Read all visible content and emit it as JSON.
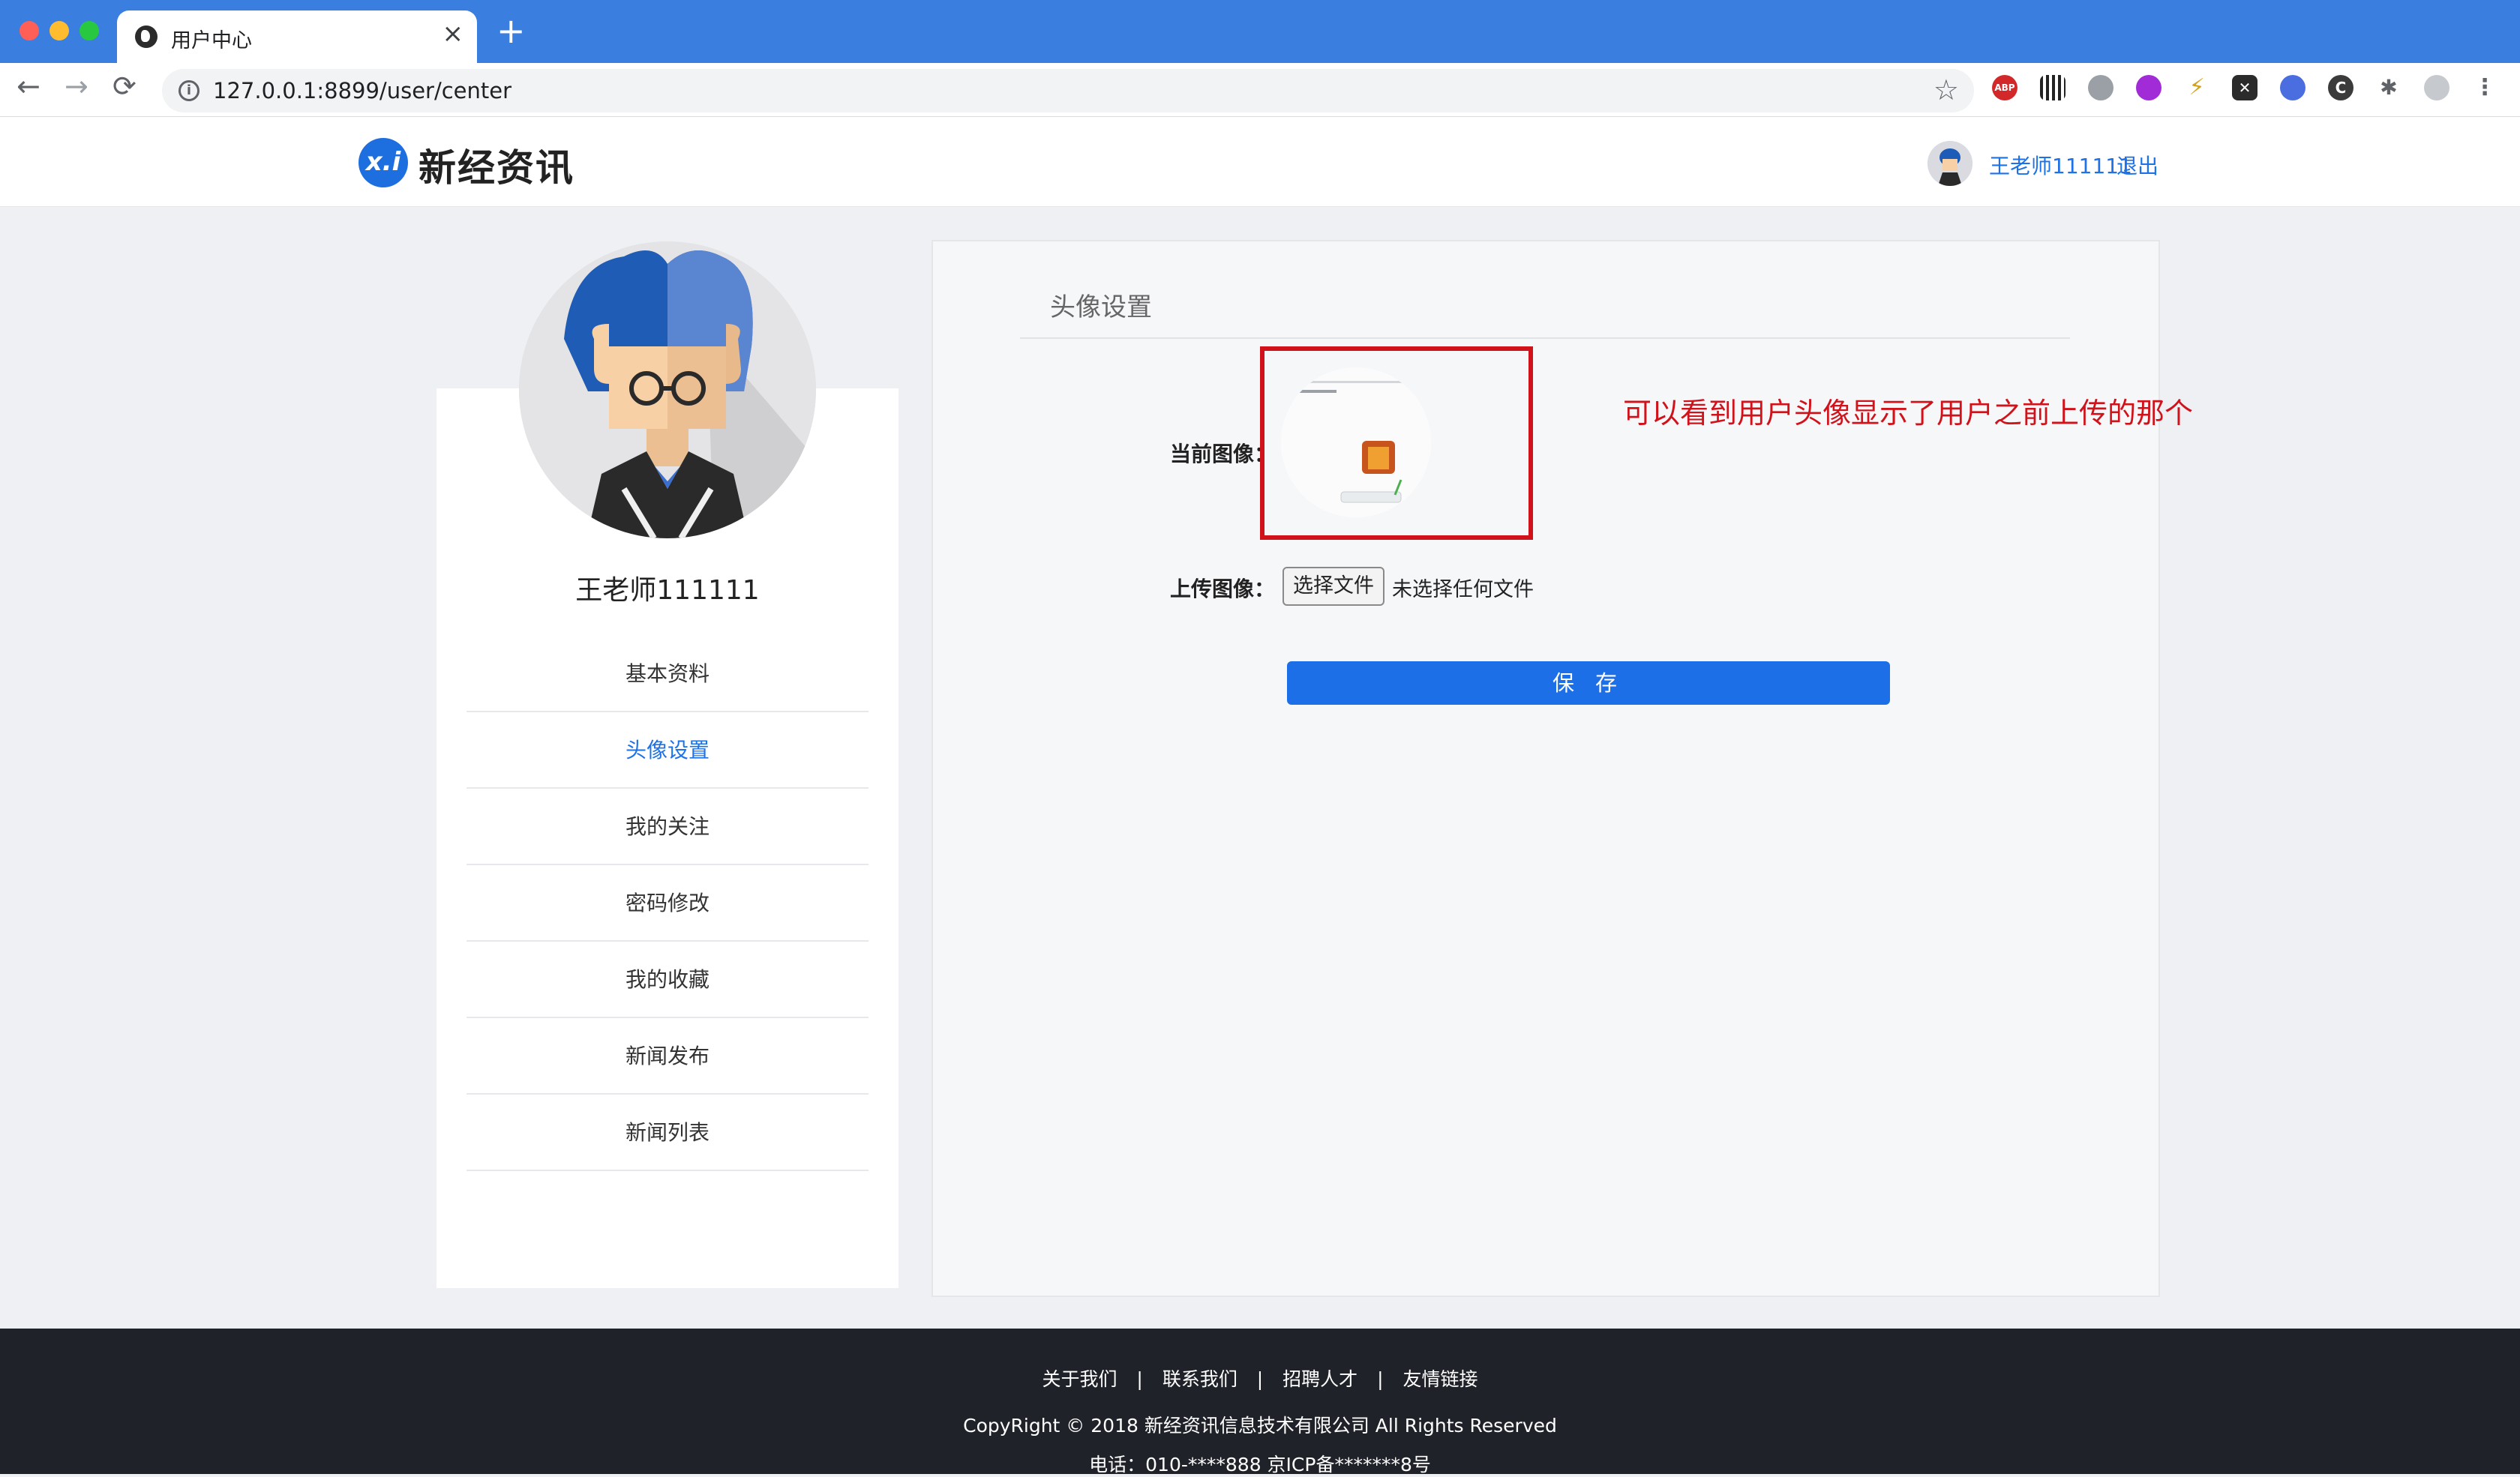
{
  "browser": {
    "tab_title": "用户中心",
    "url": "127.0.0.1:8899/user/center",
    "extensions": [
      "abp-icon",
      "qr-code-icon",
      "globe-icon",
      "purple-circle-icon",
      "lightning-icon",
      "x-icon",
      "translate-icon",
      "c-icon",
      "puzzle-icon",
      "profile-icon",
      "more-icon"
    ],
    "abp_label": "ABP"
  },
  "header": {
    "logo_mark": "x.i",
    "logo_text": "新经资讯",
    "username": "王老师111111",
    "logout": "退出"
  },
  "sidebar": {
    "username": "王老师111111",
    "items": [
      {
        "label": "基本资料",
        "active": false
      },
      {
        "label": "头像设置",
        "active": true
      },
      {
        "label": "我的关注",
        "active": false
      },
      {
        "label": "密码修改",
        "active": false
      },
      {
        "label": "我的收藏",
        "active": false
      },
      {
        "label": "新闻发布",
        "active": false
      },
      {
        "label": "新闻列表",
        "active": false
      }
    ]
  },
  "main": {
    "title": "头像设置",
    "current_label": "当前图像：",
    "upload_label": "上传图像：",
    "file_button": "选择文件",
    "file_status": "未选择任何文件",
    "save_button": "保 存",
    "annotation": "可以看到用户头像显示了用户之前上传的那个"
  },
  "footer": {
    "links": [
      "关于我们",
      "联系我们",
      "招聘人才",
      "友情链接"
    ],
    "separator": "|",
    "copyright": "CopyRight © 2018 新经资讯信息技术有限公司 All Rights Reserved",
    "contact": "电话：010-****888 京ICP备*******8号"
  },
  "colors": {
    "accent": "#1d72e8",
    "annotation_red": "#d0121b",
    "footer_bg": "#1f2229"
  }
}
